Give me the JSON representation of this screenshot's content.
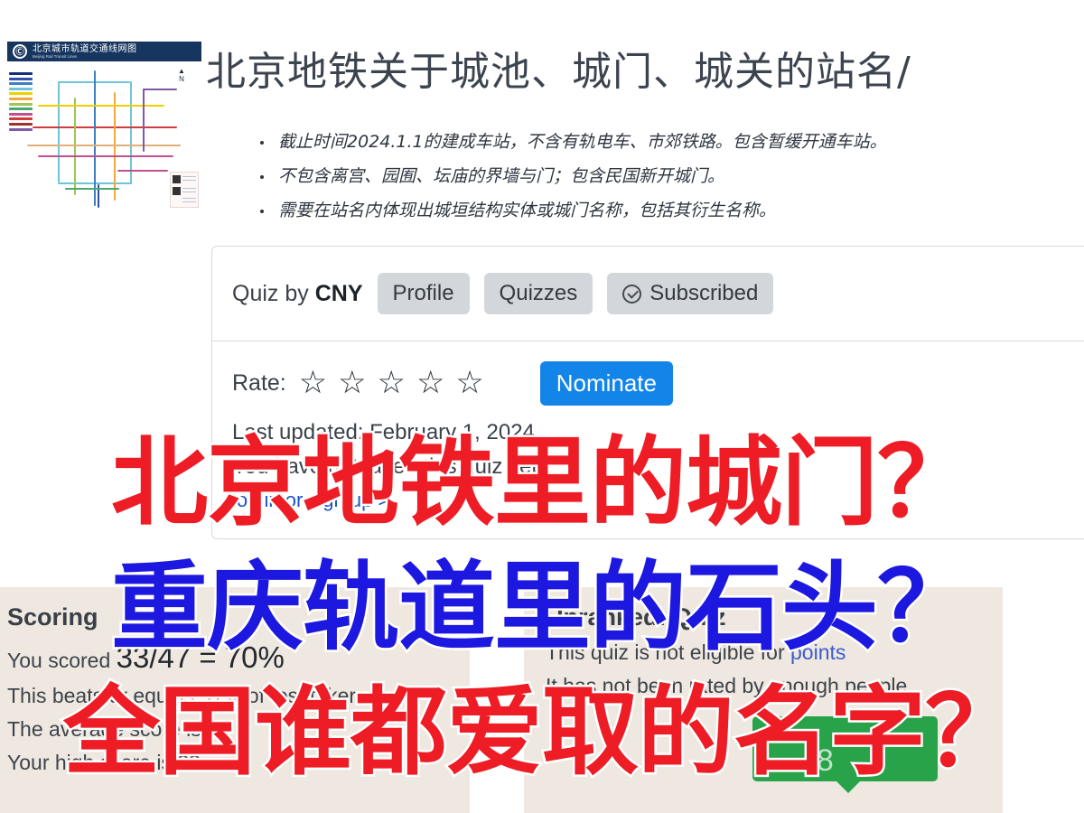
{
  "map_thumbnail": {
    "title_cn": "北京城市轨道交通线网图",
    "title_en": "Beijing Rail Transit Lines",
    "logo_glyph": "Ⓒ",
    "compass_label": "N"
  },
  "headline": "北京地铁关于城池、城门、城关的站名/",
  "bullets": [
    "截止时间2024.1.1的建成车站，不含有轨电车、市郊铁路。包含暂缓开通车站。",
    "不包含离宫、园囿、坛庙的界墙与门；包含民国新开城门。",
    "需要在站名内体现出城垣结构实体或城门名称，包括其衍生名称。"
  ],
  "quiz_card": {
    "author_prefix": "Quiz by",
    "author_name": "CNY",
    "profile_label": "Profile",
    "quizzes_label": "Quizzes",
    "subscribed_label": "Subscribed",
    "subscribed_icon": "check-circle-icon",
    "rate_label": "Rate:",
    "star_glyph": "☆",
    "star_count": 5,
    "nominate_label": "Nominate",
    "last_updated": "Last updated: February 1, 2024",
    "not_taken": "You have not taken this quiz yet",
    "login_link": "log in or sign up >"
  },
  "scoring_panel": {
    "heading": "Scoring",
    "line1_prefix": "You scored",
    "line1_score": "33/47 = 70%",
    "line2": "This beats or equals 91% of test takers",
    "line3": "The average score is 21",
    "line4": "Your high score is 33"
  },
  "ranked_panel": {
    "heading": "Unranked: Quiz",
    "line1_prefix": "This quiz is not eligible for ",
    "line1_link": "points",
    "line2": "It has not been rated by enough people",
    "badge_value": "48"
  },
  "overlay_captions": [
    {
      "text": "北京地铁里的城门？",
      "color": "#ee1c25"
    },
    {
      "text": "重庆轨道里的石头？",
      "color": "#1d18e0"
    },
    {
      "text": "全国谁都爱取的名字？",
      "color": "#ee1c25"
    }
  ],
  "colors": {
    "accent_blue": "#1384e8",
    "link_blue": "#1a53c9",
    "panel_beige": "#efe8e1",
    "badge_green": "#28a349",
    "map_header": "#17365f"
  }
}
